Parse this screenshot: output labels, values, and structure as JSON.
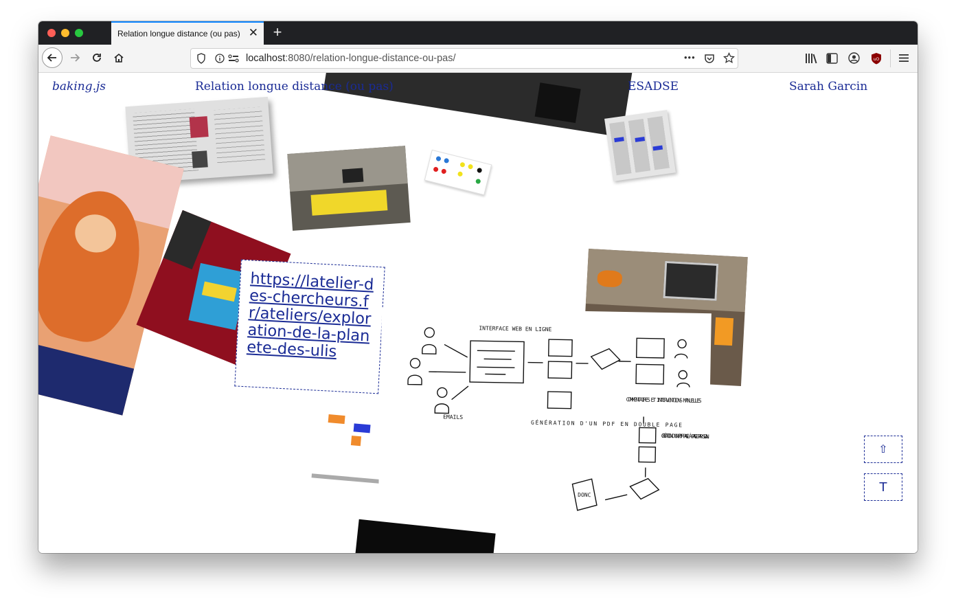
{
  "browser": {
    "tab_title": "Relation longue distance (ou pas)",
    "tab_close": "✕",
    "new_tab": "+",
    "url_host": "localhost",
    "url_path": ":8080/relation-longue-distance-ou-pas/",
    "more_label": "•••",
    "accent": "#0a84ff"
  },
  "nav": {
    "logo": "baking.js",
    "title": "Relation longue distance (ou pas)",
    "school": "ESADSE",
    "author": "Sarah Garcin",
    "link_color": "#1a2b95"
  },
  "link_card": {
    "url": "https://latelier-des-chercheurs.fr/ateliers/exploration-de-la-planete-des-ulis"
  },
  "diagram": {
    "interface_label": "INTERFACE WEB EN LIGNE",
    "emails_label": "EMAILS",
    "generation_label": "GÉNÉRATION D'UN PDF EN DOUBLE PAGE",
    "comments_label": "COMMENTAIRES ET INTERVENTIONS MANUELLES",
    "creation_label": "CRÉATION D'UN PDF PAGE À PAGE PAR SCAN",
    "book_label": "DONC"
  },
  "side_buttons": {
    "up_icon": "⇧",
    "text_icon": "T"
  }
}
